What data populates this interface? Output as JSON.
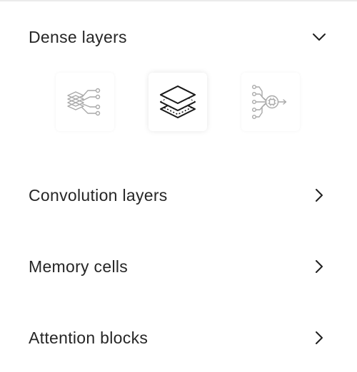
{
  "sections": [
    {
      "title": "Dense layers",
      "expanded": true,
      "chevron": "chevron-down-icon"
    },
    {
      "title": "Convolution layers",
      "expanded": false,
      "chevron": "chevron-right-icon"
    },
    {
      "title": "Memory cells",
      "expanded": false,
      "chevron": "chevron-right-icon"
    },
    {
      "title": "Attention blocks",
      "expanded": false,
      "chevron": "chevron-right-icon"
    }
  ],
  "dense_options": [
    {
      "icon": "layers-network-icon",
      "selected": false
    },
    {
      "icon": "stacked-layers-icon",
      "selected": true
    },
    {
      "icon": "neural-chip-icon",
      "selected": false
    }
  ],
  "colors": {
    "text": "#262626",
    "icon_active": "#1a1a1a",
    "icon_muted": "#a9a9a9",
    "divider": "#ebebeb"
  }
}
